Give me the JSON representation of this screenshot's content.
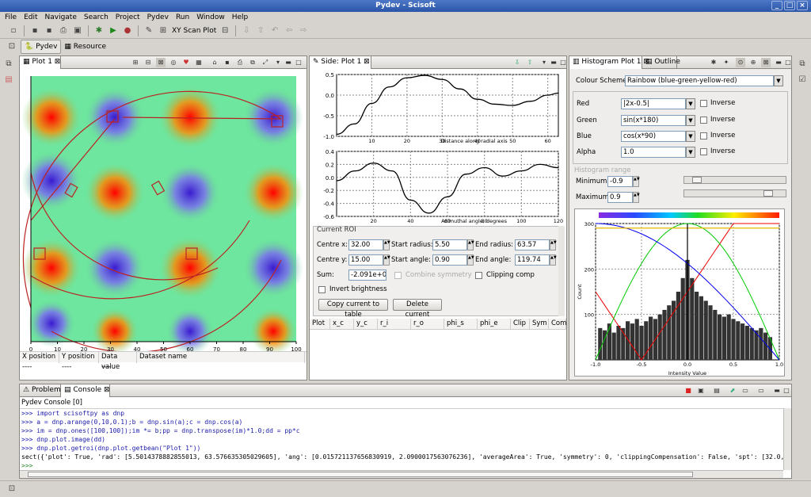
{
  "window": {
    "title": "Pydev - Scisoft"
  },
  "menu": [
    "File",
    "Edit",
    "Navigate",
    "Search",
    "Project",
    "Pydev",
    "Run",
    "Window",
    "Help"
  ],
  "toolbar": {
    "xy_scan_label": "XY Scan Plot"
  },
  "perspectives": {
    "pydev": "Pydev",
    "resource": "Resource"
  },
  "plot_view": {
    "tab": "Plot 1",
    "xticks": [
      "0",
      "10",
      "20",
      "30",
      "40",
      "50",
      "60",
      "70",
      "80",
      "90",
      "100"
    ],
    "yticks": [
      "0",
      "10",
      "20",
      "30",
      "40",
      "50",
      "60",
      "70",
      "80",
      "90",
      "100"
    ],
    "table_headers": [
      "X position",
      "Y position",
      "Data value",
      "Dataset name"
    ],
    "table_values": [
      "----",
      "----",
      "----",
      ""
    ]
  },
  "side_view": {
    "tab": "Side: Plot 1",
    "top_chart": {
      "xlabel": "Distance along radial axis",
      "yticks": [
        "0.5",
        "0.0",
        "-0.5",
        "-1.0"
      ],
      "xticks": [
        "10",
        "20",
        "30",
        "40",
        "50",
        "60"
      ]
    },
    "bottom_chart": {
      "xlabel": "Azimuthal angle, degrees",
      "yticks": [
        "0.4",
        "0.2",
        "0.0",
        "-0.2",
        "-0.4",
        "-0.6"
      ],
      "xticks": [
        "20",
        "40",
        "60",
        "80",
        "100",
        "120"
      ]
    },
    "roi": {
      "title": "Current ROI",
      "centre_x_label": "Centre x:",
      "centre_x": "32.00",
      "start_radius_label": "Start radius:",
      "start_radius": "5.50",
      "end_radius_label": "End radius:",
      "end_radius": "63.57",
      "centre_y_label": "Centre y:",
      "centre_y": "15.00",
      "start_angle_label": "Start angle:",
      "start_angle": "0.90",
      "end_angle_label": "End angle:",
      "end_angle": "119.74",
      "sum_label": "Sum:",
      "sum": "-2.091e+0",
      "combine_label": "Combine symmetry",
      "clipping_label": "Clipping comp",
      "invert_label": "Invert brightness",
      "copy_button": "Copy current to table",
      "delete_button": "Delete current"
    },
    "table_headers": [
      "Plot",
      "x_c",
      "y_c",
      "r_i",
      "r_o",
      "phi_s",
      "phi_e",
      "Clip",
      "Sym",
      "Com"
    ]
  },
  "histogram_view": {
    "tab": "Histogram Plot 1",
    "outline_tab": "Outline",
    "colour_scheme_label": "Colour Scheme",
    "colour_scheme": "Rainbow (blue-green-yellow-red)",
    "channels": [
      {
        "label": "Red",
        "value": "|2x-0.5|"
      },
      {
        "label": "Green",
        "value": "sin(x*180)"
      },
      {
        "label": "Blue",
        "value": "cos(x*90)"
      },
      {
        "label": "Alpha",
        "value": "1.0"
      }
    ],
    "inverse_label": "Inverse",
    "range_label": "Histogram range",
    "minimum_label": "Minimum",
    "minimum": "-0.9",
    "maximum_label": "Maximum",
    "maximum": "0.9",
    "chart": {
      "xlabel": "Intensity Value",
      "ylabel": "Count",
      "yticks": [
        "300",
        "200",
        "100"
      ],
      "xticks": [
        "-1.0",
        "-0.5",
        "0.0",
        "0.5",
        "1.0"
      ]
    }
  },
  "chart_data": [
    {
      "type": "line",
      "title": "",
      "xlabel": "Distance along radial axis",
      "x": [
        0,
        5,
        10,
        15,
        20,
        25,
        30,
        35,
        40,
        45,
        50,
        55,
        60,
        63
      ],
      "values": [
        -0.95,
        -0.7,
        -0.2,
        0.2,
        0.42,
        0.48,
        0.38,
        0.15,
        -0.1,
        -0.22,
        -0.25,
        -0.15,
        0.0,
        0.05
      ],
      "xlim": [
        0,
        63
      ],
      "ylim": [
        -1.0,
        0.5
      ]
    },
    {
      "type": "line",
      "title": "",
      "xlabel": "Azimuthal angle, degrees",
      "x": [
        0,
        10,
        20,
        30,
        40,
        50,
        60,
        70,
        80,
        90,
        100,
        110,
        120
      ],
      "values": [
        -0.05,
        0.1,
        0.22,
        0.1,
        -0.35,
        -0.55,
        -0.3,
        0.05,
        0.15,
        0.02,
        0.1,
        0.2,
        0.15
      ],
      "xlim": [
        0,
        120
      ],
      "ylim": [
        -0.6,
        0.4
      ]
    },
    {
      "type": "bar",
      "title": "",
      "xlabel": "Intensity Value",
      "ylabel": "Count",
      "x": [
        -0.95,
        -0.9,
        -0.85,
        -0.8,
        -0.75,
        -0.7,
        -0.65,
        -0.6,
        -0.55,
        -0.5,
        -0.45,
        -0.4,
        -0.35,
        -0.3,
        -0.25,
        -0.2,
        -0.15,
        -0.1,
        -0.05,
        0.0,
        0.05,
        0.1,
        0.15,
        0.2,
        0.25,
        0.3,
        0.35,
        0.4,
        0.45,
        0.5,
        0.55,
        0.6,
        0.65,
        0.7,
        0.75,
        0.8,
        0.85,
        0.9
      ],
      "values": [
        70,
        65,
        80,
        60,
        75,
        70,
        85,
        80,
        90,
        75,
        85,
        95,
        90,
        100,
        110,
        120,
        130,
        150,
        180,
        220,
        180,
        150,
        140,
        130,
        120,
        110,
        100,
        95,
        100,
        90,
        85,
        80,
        75,
        70,
        65,
        70,
        60,
        50
      ],
      "xlim": [
        -1.0,
        1.0
      ],
      "ylim": [
        0,
        300
      ]
    }
  ],
  "console": {
    "problems_tab": "Problems",
    "console_tab": "Console",
    "header": "Pydev Console [0]",
    "lines": [
      ">>> import scisoftpy as dnp",
      ">>> a = dnp.arange(0,10,0.1);b = dnp.sin(a);c = dnp.cos(a)",
      ">>> im = dnp.ones([100,100]);im *= b;pp = dnp.transpose(im)*1.0;dd = pp*c",
      ">>> dnp.plot.image(dd)",
      ">>> dnp.plot.getroi(dnp.plot.getbean(\"Plot 1\"))",
      "sect({'plot': True, 'rad': [5.5014378882855013, 63.576635305029605], 'ang': [0.015721137656830919, 2.0900017563076236], 'averageArea': True, 'symmetry': 0, 'clippingCompensation': False, 'spt': [32.0,",
      ">>> "
    ]
  }
}
